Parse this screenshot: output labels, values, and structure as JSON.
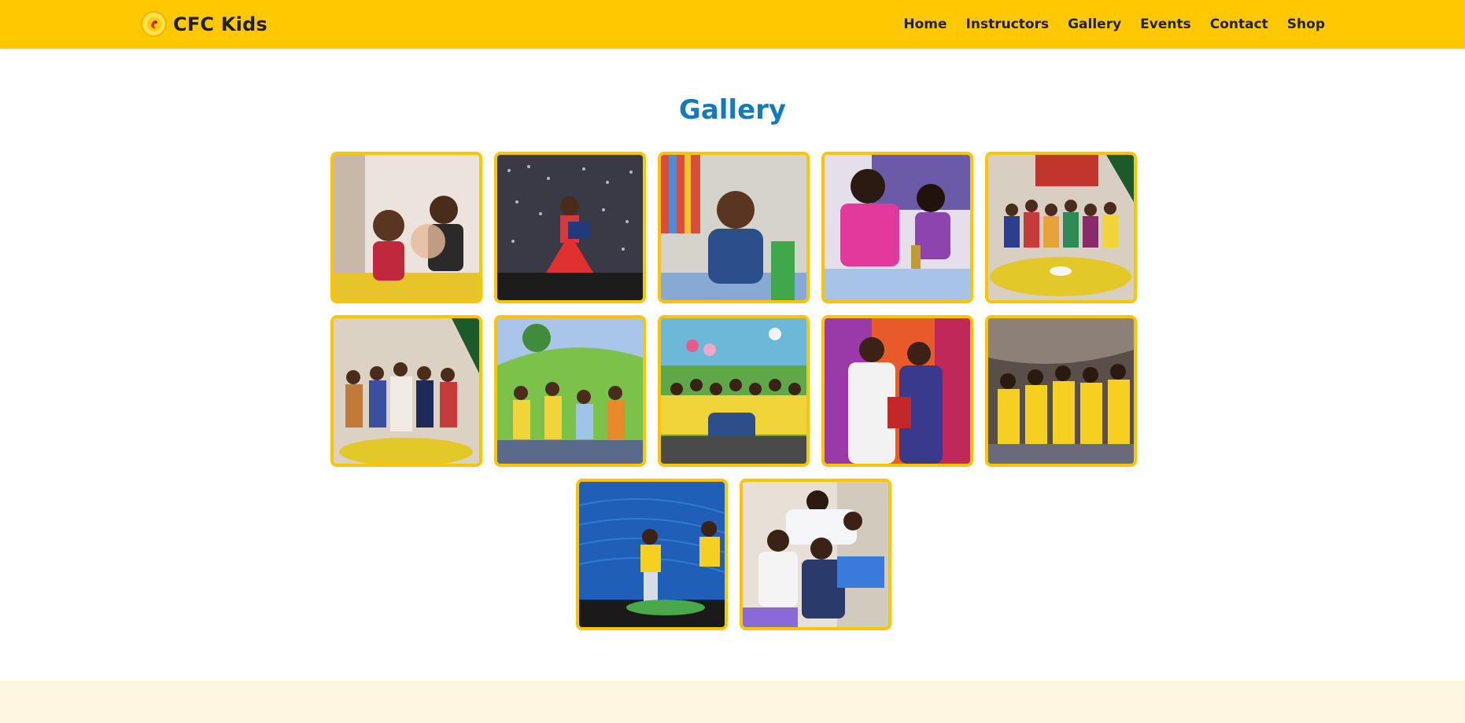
{
  "header": {
    "brand": "CFC Kids",
    "nav": [
      {
        "label": "Home"
      },
      {
        "label": "Instructors"
      },
      {
        "label": "Gallery"
      },
      {
        "label": "Events"
      },
      {
        "label": "Contact"
      },
      {
        "label": "Shop"
      }
    ]
  },
  "main": {
    "title": "Gallery",
    "photos": [
      {
        "name": "gallery-photo-1"
      },
      {
        "name": "gallery-photo-2"
      },
      {
        "name": "gallery-photo-3"
      },
      {
        "name": "gallery-photo-4"
      },
      {
        "name": "gallery-photo-5"
      },
      {
        "name": "gallery-photo-6"
      },
      {
        "name": "gallery-photo-7"
      },
      {
        "name": "gallery-photo-8"
      },
      {
        "name": "gallery-photo-9"
      },
      {
        "name": "gallery-photo-10"
      },
      {
        "name": "gallery-photo-11"
      },
      {
        "name": "gallery-photo-12"
      }
    ]
  },
  "colors": {
    "header": "#ffc800",
    "title": "#137bbd",
    "tile_border": "#ffc400",
    "footer": "#fff6e2"
  }
}
